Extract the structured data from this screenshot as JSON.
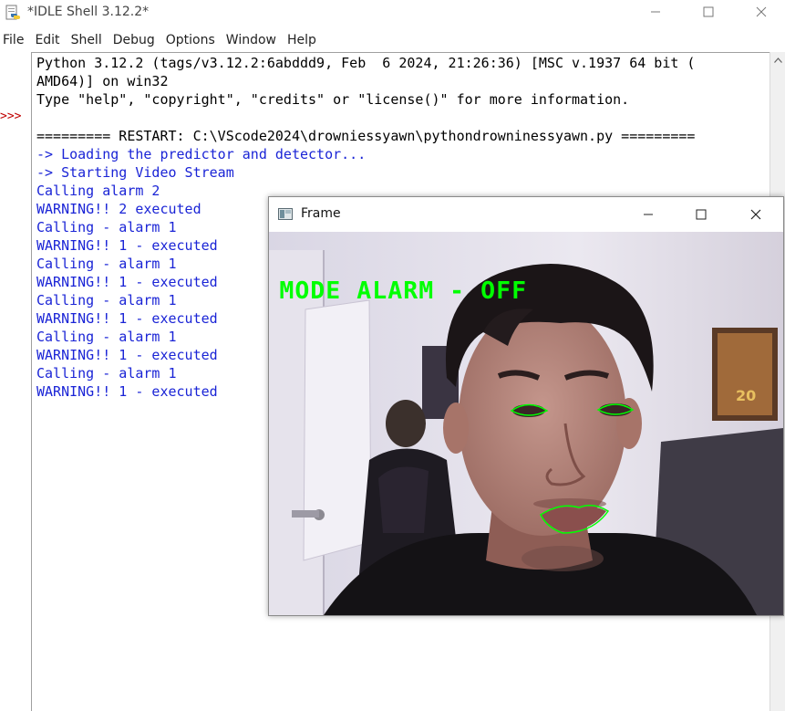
{
  "window": {
    "title": "*IDLE Shell 3.12.2*",
    "icon": "python-idle-icon",
    "controls": [
      "minimize-icon",
      "maximize-icon",
      "close-icon"
    ]
  },
  "menu": [
    "File",
    "Edit",
    "Shell",
    "Debug",
    "Options",
    "Window",
    "Help"
  ],
  "shell": {
    "prompt": ">>>",
    "lines": [
      {
        "text": "Python 3.12.2 (tags/v3.12.2:6abddd9, Feb  6 2024, 21:26:36) [MSC v.1937 64 bit (",
        "color": "black"
      },
      {
        "text": "AMD64)] on win32",
        "color": "black"
      },
      {
        "text": "Type \"help\", \"copyright\", \"credits\" or \"license()\" for more information.",
        "color": "black"
      },
      {
        "text": "",
        "color": "black"
      },
      {
        "text": "========= RESTART: C:\\VScode2024\\drowniessyawn\\pythondrowninessyawn.py =========",
        "color": "black"
      },
      {
        "text": "-> Loading the predictor and detector...",
        "color": "blue"
      },
      {
        "text": "-> Starting Video Stream",
        "color": "blue"
      },
      {
        "text": "Calling alarm 2",
        "color": "blue"
      },
      {
        "text": "WARNING!! 2 executed",
        "color": "blue"
      },
      {
        "text": "Calling - alarm 1",
        "color": "blue"
      },
      {
        "text": "WARNING!! 1 - executed",
        "color": "blue"
      },
      {
        "text": "Calling - alarm 1",
        "color": "blue"
      },
      {
        "text": "WARNING!! 1 - executed",
        "color": "blue"
      },
      {
        "text": "Calling - alarm 1",
        "color": "blue"
      },
      {
        "text": "WARNING!! 1 - executed",
        "color": "blue"
      },
      {
        "text": "Calling - alarm 1",
        "color": "blue"
      },
      {
        "text": "WARNING!! 1 - executed",
        "color": "blue"
      },
      {
        "text": "Calling - alarm 1",
        "color": "blue"
      },
      {
        "text": "WARNING!! 1 - executed",
        "color": "blue"
      }
    ]
  },
  "frame_window": {
    "title": "Frame",
    "overlay_text": "MODE ALARM - OFF",
    "overlay_color": "#00ff00",
    "contour_color": "#00ff00"
  },
  "colors": {
    "stdout_blue": "#1a24d6",
    "prompt_red": "#c00000"
  }
}
